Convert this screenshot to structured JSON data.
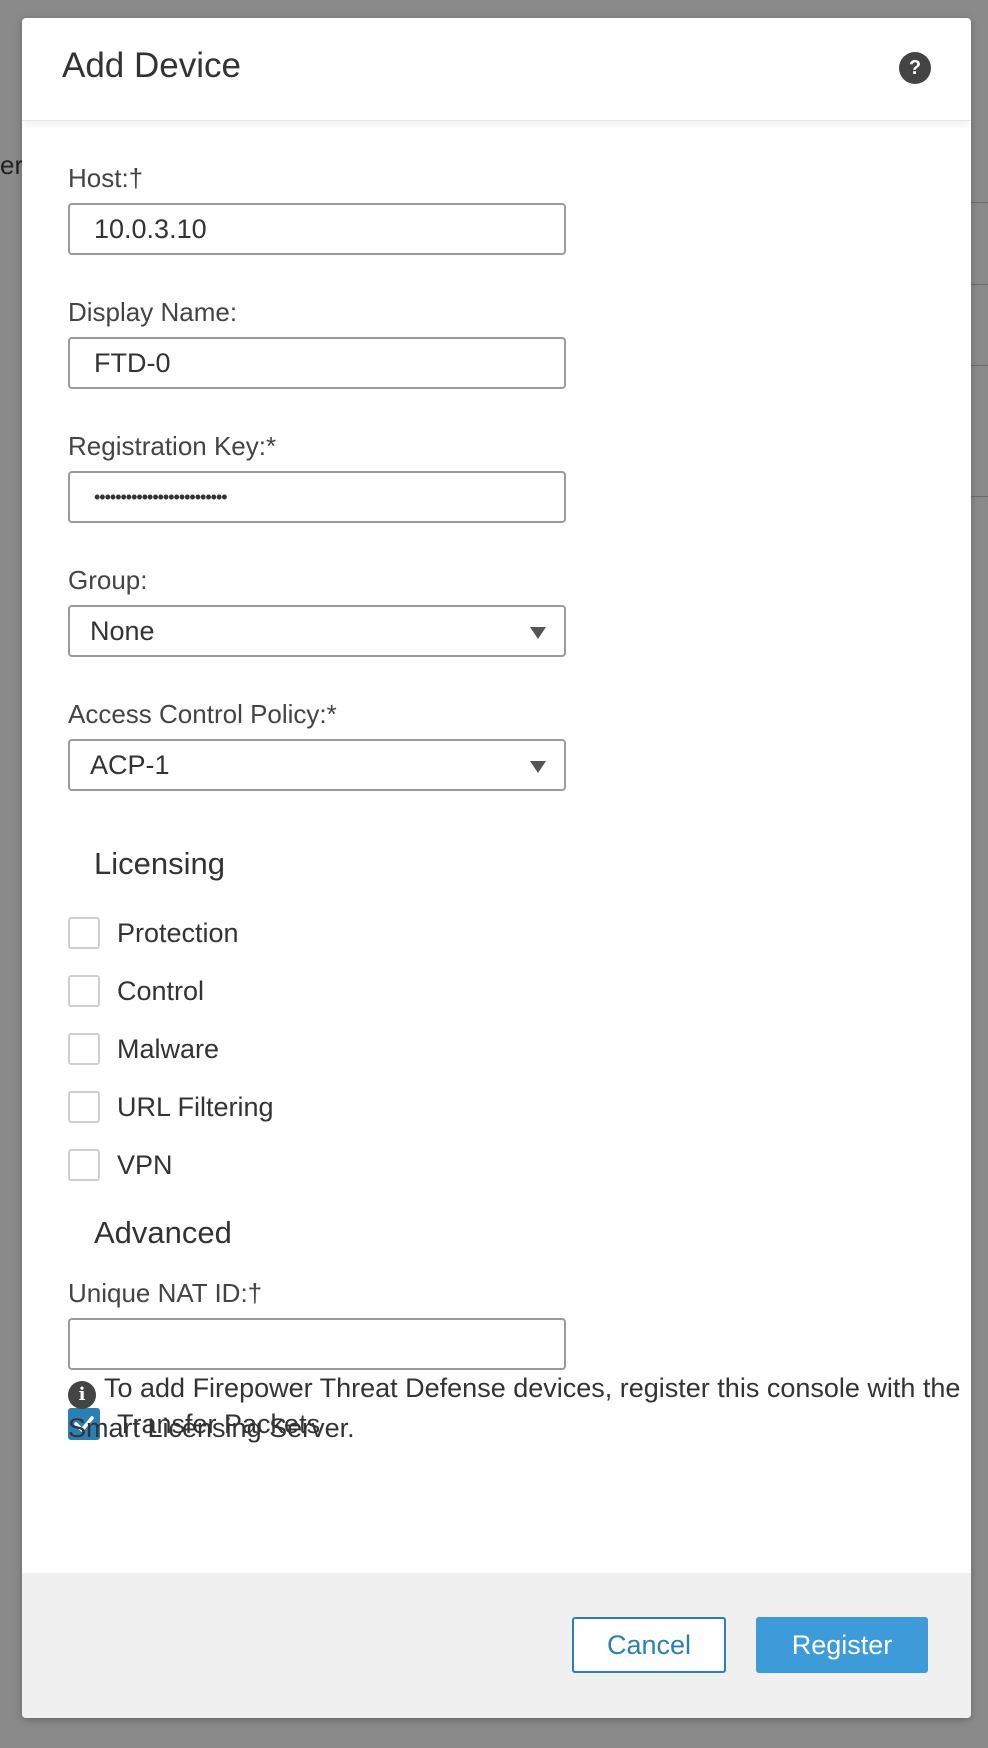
{
  "background": {
    "fragment_text": "er"
  },
  "modal": {
    "title": "Add Device",
    "help_icon": "?"
  },
  "fields": {
    "host": {
      "label": "Host:†",
      "value": "10.0.3.10"
    },
    "display_name": {
      "label": "Display Name:",
      "value": "FTD-0"
    },
    "registration_key": {
      "label": "Registration Key:*",
      "value": "•••••••••••••••••••••••••"
    },
    "group": {
      "label": "Group:",
      "value": "None"
    },
    "access_control_policy": {
      "label": "Access Control Policy:*",
      "value": "ACP-1"
    }
  },
  "licensing": {
    "title": "Licensing",
    "options": [
      {
        "label": "Protection",
        "checked": false
      },
      {
        "label": "Control",
        "checked": false
      },
      {
        "label": "Malware",
        "checked": false
      },
      {
        "label": "URL Filtering",
        "checked": false
      },
      {
        "label": "VPN",
        "checked": false
      }
    ]
  },
  "advanced": {
    "title": "Advanced",
    "unique_nat_id": {
      "label": "Unique NAT ID:†",
      "value": ""
    },
    "transfer_packets": {
      "label": "Transfer Packets",
      "checked": true
    }
  },
  "info": {
    "icon": "i",
    "text": "To add Firepower Threat Defense devices, register this console with the Smart Licensing Server."
  },
  "buttons": {
    "cancel": "Cancel",
    "register": "Register"
  },
  "colors": {
    "accent": "#2b7fb3",
    "primary_button": "#3d9bd9",
    "overlay": "#8a8a8a"
  }
}
